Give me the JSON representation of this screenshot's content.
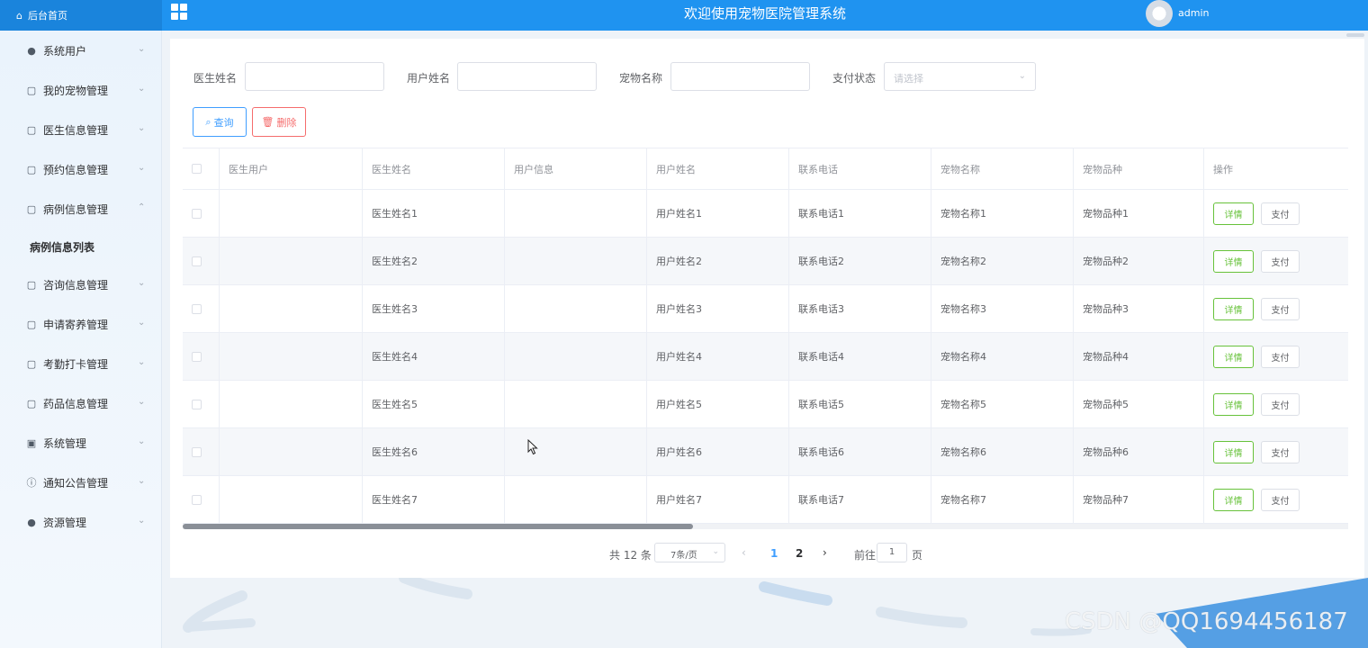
{
  "header": {
    "home_label": "后台首页",
    "title": "欢迎使用宠物医院管理系统",
    "username": "admin"
  },
  "sidebar": {
    "items": [
      {
        "label": "系统用户",
        "icon": "user-icon"
      },
      {
        "label": "我的宠物管理",
        "icon": "folder-icon"
      },
      {
        "label": "医生信息管理",
        "icon": "folder-icon"
      },
      {
        "label": "预约信息管理",
        "icon": "folder-icon"
      },
      {
        "label": "病例信息管理",
        "icon": "folder-icon",
        "expanded": true
      },
      {
        "label": "咨询信息管理",
        "icon": "folder-icon"
      },
      {
        "label": "申请寄养管理",
        "icon": "folder-icon"
      },
      {
        "label": "考勤打卡管理",
        "icon": "folder-icon"
      },
      {
        "label": "药品信息管理",
        "icon": "folder-icon"
      },
      {
        "label": "系统管理",
        "icon": "picture-icon"
      },
      {
        "label": "通知公告管理",
        "icon": "info-icon"
      },
      {
        "label": "资源管理",
        "icon": "location-icon"
      }
    ],
    "sub_item": "病例信息列表"
  },
  "filters": {
    "doctor_name_label": "医生姓名",
    "user_name_label": "用户姓名",
    "pet_name_label": "宠物名称",
    "pay_status_label": "支付状态",
    "pay_status_placeholder": "请选择"
  },
  "actions": {
    "search_label": "查询",
    "delete_label": "删除"
  },
  "table": {
    "columns": [
      "医生用户",
      "医生姓名",
      "用户信息",
      "用户姓名",
      "联系电话",
      "宠物名称",
      "宠物品种",
      "操作"
    ],
    "rows": [
      {
        "doctor_user": "",
        "doctor_name": "医生姓名1",
        "user_info": "",
        "user_name": "用户姓名1",
        "phone": "联系电话1",
        "pet_name": "宠物名称1",
        "pet_breed": "宠物品种1"
      },
      {
        "doctor_user": "",
        "doctor_name": "医生姓名2",
        "user_info": "",
        "user_name": "用户姓名2",
        "phone": "联系电话2",
        "pet_name": "宠物名称2",
        "pet_breed": "宠物品种2"
      },
      {
        "doctor_user": "",
        "doctor_name": "医生姓名3",
        "user_info": "",
        "user_name": "用户姓名3",
        "phone": "联系电话3",
        "pet_name": "宠物名称3",
        "pet_breed": "宠物品种3"
      },
      {
        "doctor_user": "",
        "doctor_name": "医生姓名4",
        "user_info": "",
        "user_name": "用户姓名4",
        "phone": "联系电话4",
        "pet_name": "宠物名称4",
        "pet_breed": "宠物品种4"
      },
      {
        "doctor_user": "",
        "doctor_name": "医生姓名5",
        "user_info": "",
        "user_name": "用户姓名5",
        "phone": "联系电话5",
        "pet_name": "宠物名称5",
        "pet_breed": "宠物品种5"
      },
      {
        "doctor_user": "",
        "doctor_name": "医生姓名6",
        "user_info": "",
        "user_name": "用户姓名6",
        "phone": "联系电话6",
        "pet_name": "宠物名称6",
        "pet_breed": "宠物品种6"
      },
      {
        "doctor_user": "",
        "doctor_name": "医生姓名7",
        "user_info": "",
        "user_name": "用户姓名7",
        "phone": "联系电话7",
        "pet_name": "宠物名称7",
        "pet_breed": "宠物品种7"
      }
    ],
    "detail_label": "详情",
    "pay_label": "支付"
  },
  "pagination": {
    "total_text": "共 12 条",
    "page_size": "7条/页",
    "pages": [
      "1",
      "2"
    ],
    "current_page": "1",
    "goto_label": "前往",
    "goto_value": "1",
    "page_suffix": "页"
  },
  "watermark": "CSDN @QQ1694456187",
  "colors": {
    "topbar": "#1f93f0",
    "primary": "#409eff",
    "danger": "#f56c6c",
    "success": "#67c23a"
  }
}
